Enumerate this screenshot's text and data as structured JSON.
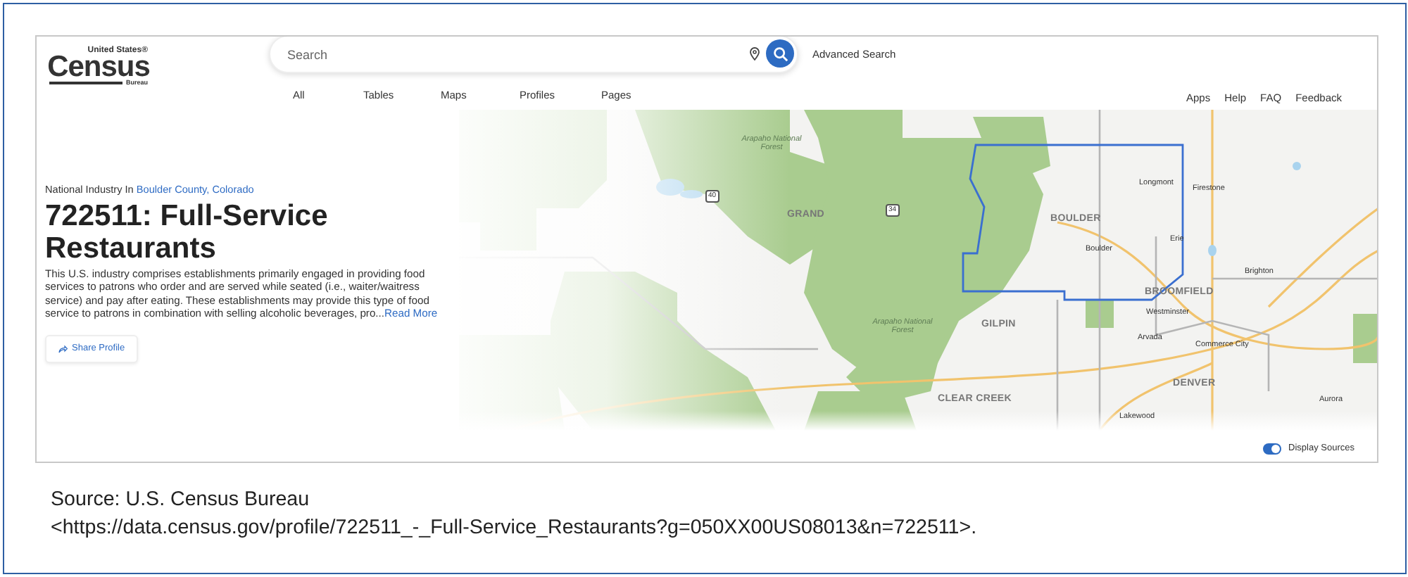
{
  "logo": {
    "top": "United States®",
    "main": "Census",
    "bottom": "Bureau"
  },
  "search": {
    "placeholder": "Search"
  },
  "advanced_search": "Advanced Search",
  "nav": [
    {
      "label": "All"
    },
    {
      "label": "Tables"
    },
    {
      "label": "Maps"
    },
    {
      "label": "Profiles"
    },
    {
      "label": "Pages"
    }
  ],
  "utility_links": [
    "Apps",
    "Help",
    "FAQ",
    "Feedback"
  ],
  "breadcrumb": {
    "prefix": "National Industry In",
    "link": "Boulder County, Colorado"
  },
  "title": "722511: Full-Service Restaurants",
  "description": "This U.S. industry comprises establishments primarily engaged in providing food services to patrons who order and are served while seated (i.e., waiter/waitress service) and pay after eating. These establishments may provide this type of food service to patrons in combination with selling alcoholic beverages, pro...",
  "read_more": "Read More",
  "share_button": "Share Profile",
  "map": {
    "labels": [
      {
        "kind": "forest",
        "text": "Arapaho National Forest"
      },
      {
        "kind": "shield",
        "text": "40"
      },
      {
        "kind": "county",
        "text": "GRAND"
      },
      {
        "kind": "shield",
        "text": "34"
      },
      {
        "kind": "county",
        "text": "BOULDER"
      },
      {
        "kind": "city",
        "text": "Longmont"
      },
      {
        "kind": "city",
        "text": "Firestone"
      },
      {
        "kind": "city",
        "text": "Erie"
      },
      {
        "kind": "city",
        "text": "Boulder"
      },
      {
        "kind": "city",
        "text": "Brighton"
      },
      {
        "kind": "county",
        "text": "BROOMFIELD"
      },
      {
        "kind": "city",
        "text": "Westminster"
      },
      {
        "kind": "forest",
        "text": "Arapaho National Forest"
      },
      {
        "kind": "county",
        "text": "GILPIN"
      },
      {
        "kind": "city",
        "text": "Arvada"
      },
      {
        "kind": "city",
        "text": "Commerce City"
      },
      {
        "kind": "county",
        "text": "DENVER"
      },
      {
        "kind": "city",
        "text": "Aurora"
      },
      {
        "kind": "county",
        "text": "CLEAR CREEK"
      },
      {
        "kind": "city",
        "text": "Lakewood"
      }
    ]
  },
  "display_sources": {
    "label": "Display Sources",
    "on": true
  },
  "caption": {
    "line_1": "Source: U.S. Census Bureau",
    "line_2": "<https://data.census.gov/profile/722511_-_Full-Service_Restaurants?g=050XX00US08013&n=722511>."
  }
}
